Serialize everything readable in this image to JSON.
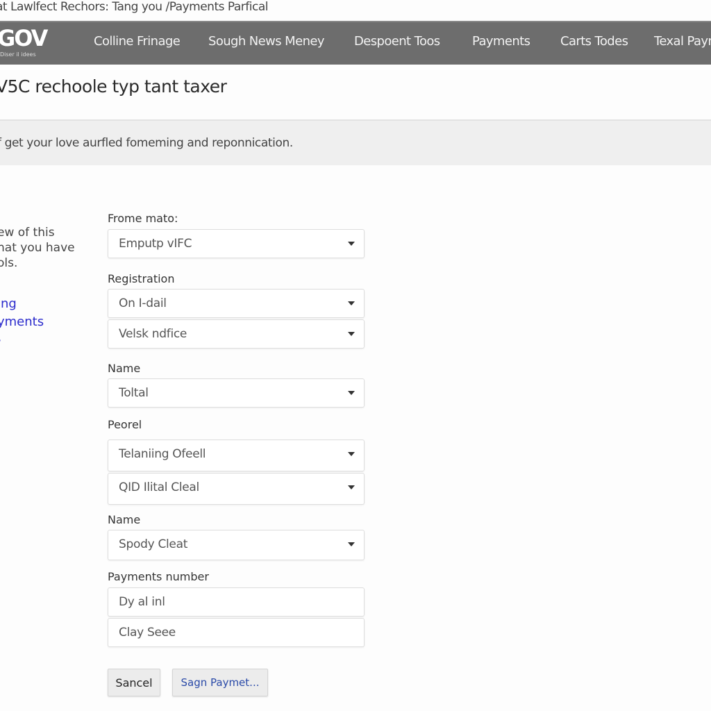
{
  "breadcrumb": "at Lawlfect Rechors: Tang you /Payments Parfical",
  "nav": {
    "logo": "GOV",
    "logo_sub": "Diser il idees",
    "items": [
      "Colline Frinage",
      "Sough News Meney",
      "Despoent Toos",
      "Payments",
      "Carts Todes",
      "Texal Payments"
    ]
  },
  "page_title": "V5C rechoole typ tant taxer",
  "intro": "f get your love aurfled fomeming and reponnication.",
  "sidebar": {
    "text_lines": [
      "ew of this",
      "hat you have",
      "ols."
    ],
    "links": [
      "ing",
      "yments",
      "s"
    ],
    "link_color": "#2b2bcc"
  },
  "form": {
    "label1": "Frome mato:",
    "select1": "Emputp vIFC",
    "label2": "Registration",
    "select2a": "On I-dail",
    "select2b": "Velsk ndfice",
    "label3": "Name",
    "select3": "Toltal",
    "label4": "Peorel",
    "select4a": "Telaniing Ofeell",
    "select4b": "QID Ilital Cleal",
    "label5": "Name",
    "select5": "Spody Cleat",
    "label6": "Payments number",
    "input6a": "Dy al inl",
    "input6b": "Clay Seee"
  },
  "buttons": {
    "cancel": "Sancel",
    "submit": "Sagn Paymet...",
    "submit_color": "#2a4aa8"
  },
  "colors": {
    "nav_bg": "#6d6d6d",
    "band_bg": "#efefef"
  }
}
